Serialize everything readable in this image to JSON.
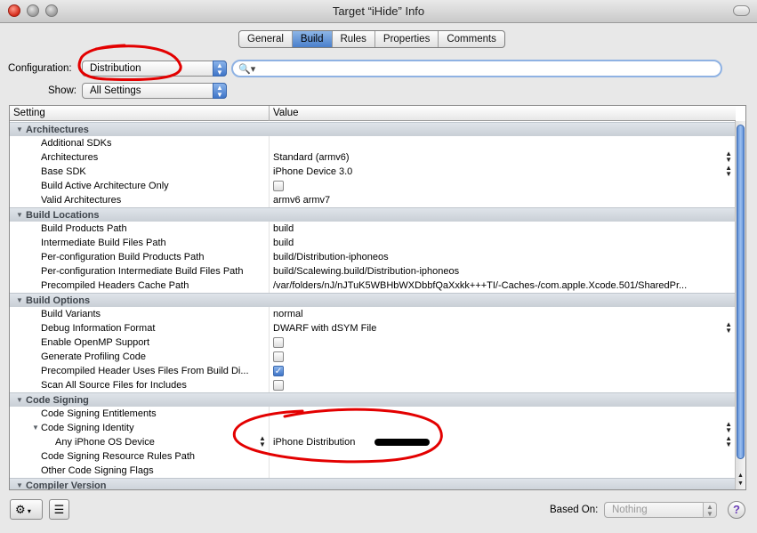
{
  "window": {
    "title": "Target “iHide” Info"
  },
  "tabs": [
    {
      "label": "General",
      "active": false
    },
    {
      "label": "Build",
      "active": true
    },
    {
      "label": "Rules",
      "active": false
    },
    {
      "label": "Properties",
      "active": false
    },
    {
      "label": "Comments",
      "active": false
    }
  ],
  "toolbar": {
    "configuration_label": "Configuration:",
    "configuration_value": "Distribution",
    "show_label": "Show:",
    "show_value": "All Settings",
    "search_placeholder": ""
  },
  "table": {
    "header_setting": "Setting",
    "header_value": "Value",
    "rows": [
      {
        "type": "group",
        "name": "Architectures"
      },
      {
        "type": "item",
        "name": "Additional SDKs",
        "value": ""
      },
      {
        "type": "item",
        "name": "Architectures",
        "value": "Standard (armv6)",
        "stepper": true
      },
      {
        "type": "item",
        "name": "Base SDK",
        "value": "iPhone Device 3.0",
        "stepper": true
      },
      {
        "type": "item",
        "name": "Build Active Architecture Only",
        "checkbox": false
      },
      {
        "type": "item",
        "name": "Valid Architectures",
        "value": "armv6 armv7"
      },
      {
        "type": "group",
        "name": "Build Locations"
      },
      {
        "type": "item",
        "name": "Build Products Path",
        "value": "build"
      },
      {
        "type": "item",
        "name": "Intermediate Build Files Path",
        "value": "build"
      },
      {
        "type": "item",
        "name": "Per-configuration Build Products Path",
        "value": "build/Distribution-iphoneos"
      },
      {
        "type": "item",
        "name": "Per-configuration Intermediate Build Files Path",
        "value": "build/Scalewing.build/Distribution-iphoneos"
      },
      {
        "type": "item",
        "name": "Precompiled Headers Cache Path",
        "value": "/var/folders/nJ/nJTuK5WBHbWXDbbfQaXxkk+++TI/-Caches-/com.apple.Xcode.501/SharedPr..."
      },
      {
        "type": "group",
        "name": "Build Options"
      },
      {
        "type": "item",
        "name": "Build Variants",
        "value": "normal"
      },
      {
        "type": "item",
        "name": "Debug Information Format",
        "value": "DWARF with dSYM File",
        "stepper": true
      },
      {
        "type": "item",
        "name": "Enable OpenMP Support",
        "checkbox": false
      },
      {
        "type": "item",
        "name": "Generate Profiling Code",
        "checkbox": false
      },
      {
        "type": "item",
        "name": "Precompiled Header Uses Files From Build Di...",
        "checkbox": true
      },
      {
        "type": "item",
        "name": "Scan All Source Files for Includes",
        "checkbox": false
      },
      {
        "type": "group",
        "name": "Code Signing"
      },
      {
        "type": "item",
        "name": "Code Signing Entitlements",
        "value": ""
      },
      {
        "type": "item",
        "name": "Code Signing Identity",
        "value": "",
        "expanded": true,
        "stepper": true
      },
      {
        "type": "subitem",
        "name": "Any iPhone OS Device",
        "value": "iPhone Distribution",
        "stepper": true,
        "name_stepper": true,
        "redacted": true
      },
      {
        "type": "item",
        "name": "Code Signing Resource Rules Path",
        "value": ""
      },
      {
        "type": "item",
        "name": "Other Code Signing Flags",
        "value": ""
      },
      {
        "type": "group",
        "name": "Compiler Version"
      }
    ]
  },
  "bottom": {
    "based_on_label": "Based On:",
    "based_on_value": "Nothing",
    "help_label": "?"
  }
}
